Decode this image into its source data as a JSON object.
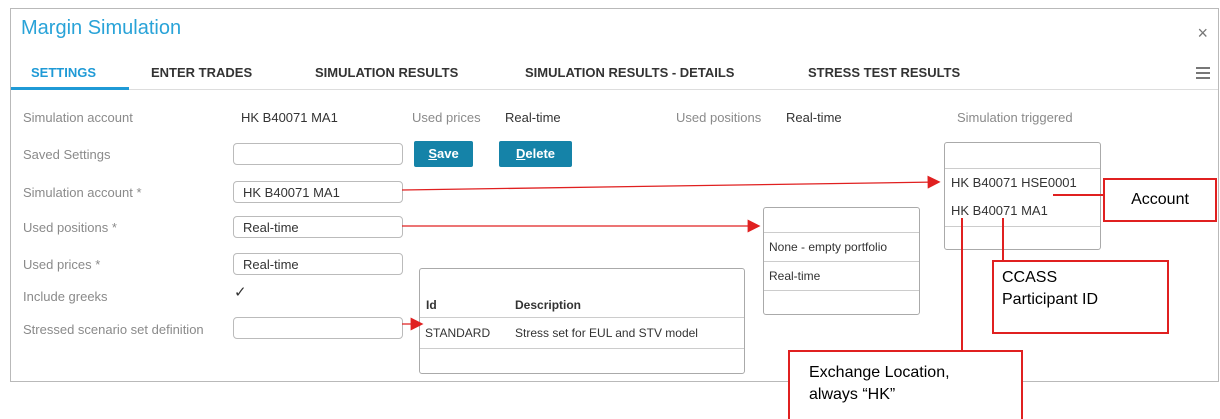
{
  "window": {
    "title": "Margin Simulation",
    "close": "×"
  },
  "tabs": [
    {
      "label": "SETTINGS"
    },
    {
      "label": "ENTER TRADES"
    },
    {
      "label": "SIMULATION RESULTS"
    },
    {
      "label": "SIMULATION RESULTS - DETAILS"
    },
    {
      "label": "STRESS TEST RESULTS"
    }
  ],
  "summary": {
    "account_label": "Simulation account",
    "account_value": "HK B40071 MA1",
    "prices_label": "Used prices",
    "prices_value": "Real-time",
    "positions_label": "Used positions",
    "positions_value": "Real-time",
    "triggered_label": "Simulation triggered"
  },
  "form": {
    "saved_settings_label": "Saved Settings",
    "saved_settings_value": "",
    "save_button_hotkey": "S",
    "save_button_rest": "ave",
    "delete_button_hotkey": "D",
    "delete_button_rest": "elete",
    "account_label": "Simulation account *",
    "account_value": "HK B40071 MA1",
    "positions_label": "Used positions *",
    "positions_value": "Real-time",
    "prices_label": "Used prices *",
    "prices_value": "Real-time",
    "greeks_label": "Include greeks",
    "greeks_checked": "✓",
    "stress_label": "Stressed scenario set definition",
    "stress_value": ""
  },
  "account_dropdown": {
    "options": [
      "",
      "HK B40071 HSE0001",
      "HK B40071 MA1",
      ""
    ]
  },
  "positions_dropdown": {
    "options": [
      "",
      "None - empty portfolio",
      "Real-time",
      ""
    ]
  },
  "stress_dropdown": {
    "headers": [
      "Id",
      "Description"
    ],
    "rows": [
      {
        "id": "STANDARD",
        "description": "Stress set for EUL and STV model"
      }
    ]
  },
  "annotations": {
    "account": "Account",
    "ccass_line1": "CCASS",
    "ccass_line2": "Participant ID",
    "exchange_line1": "Exchange Location,",
    "exchange_line2": "always “HK”"
  },
  "colors": {
    "accent": "#1f9ad6",
    "button": "#1583a8",
    "annotation": "#e02020"
  }
}
